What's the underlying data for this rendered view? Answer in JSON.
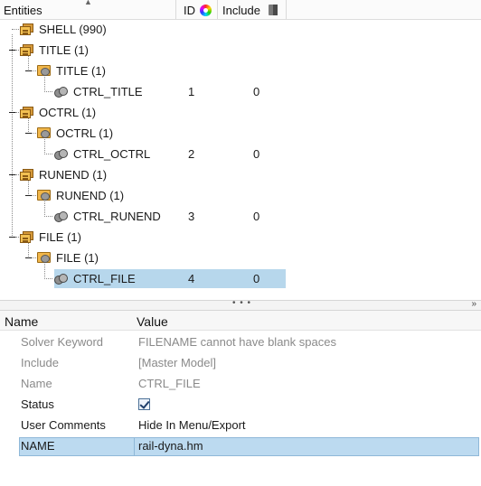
{
  "tree": {
    "columns": {
      "entities": "Entities",
      "id": "ID",
      "include": "Include"
    },
    "rows": [
      {
        "label": "SHELL  (990)",
        "id": "",
        "include": ""
      },
      {
        "label": "TITLE  (1)",
        "id": "",
        "include": ""
      },
      {
        "label": "TITLE  (1)",
        "id": "",
        "include": ""
      },
      {
        "label": "CTRL_TITLE",
        "id": "1",
        "include": "0"
      },
      {
        "label": "OCTRL  (1)",
        "id": "",
        "include": ""
      },
      {
        "label": "OCTRL  (1)",
        "id": "",
        "include": ""
      },
      {
        "label": "CTRL_OCTRL",
        "id": "2",
        "include": "0"
      },
      {
        "label": "RUNEND  (1)",
        "id": "",
        "include": ""
      },
      {
        "label": "RUNEND  (1)",
        "id": "",
        "include": ""
      },
      {
        "label": "CTRL_RUNEND",
        "id": "3",
        "include": "0"
      },
      {
        "label": "FILE  (1)",
        "id": "",
        "include": ""
      },
      {
        "label": "FILE  (1)",
        "id": "",
        "include": ""
      },
      {
        "label": "CTRL_FILE",
        "id": "4",
        "include": "0"
      }
    ],
    "selected_row": "CTRL_FILE"
  },
  "splitter": {
    "grip": "• • •",
    "collapse_icon": "double-chevron-down-icon"
  },
  "properties": {
    "columns": {
      "name": "Name",
      "value": "Value"
    },
    "rows": [
      {
        "name": "Solver Keyword",
        "value": "FILENAME cannot have blank spaces"
      },
      {
        "name": "Include",
        "value": "[Master Model]"
      },
      {
        "name": "Name",
        "value": "CTRL_FILE"
      },
      {
        "name": "Status",
        "value": "",
        "checked": true
      },
      {
        "name": "User Comments",
        "value": "Hide In Menu/Export"
      },
      {
        "name": "NAME",
        "value": "rail-dyna.hm"
      }
    ]
  },
  "colors": {
    "selection": "#b7d7ec",
    "muted_text": "#8a8a8a",
    "header_bg": "#fbfbfb"
  }
}
